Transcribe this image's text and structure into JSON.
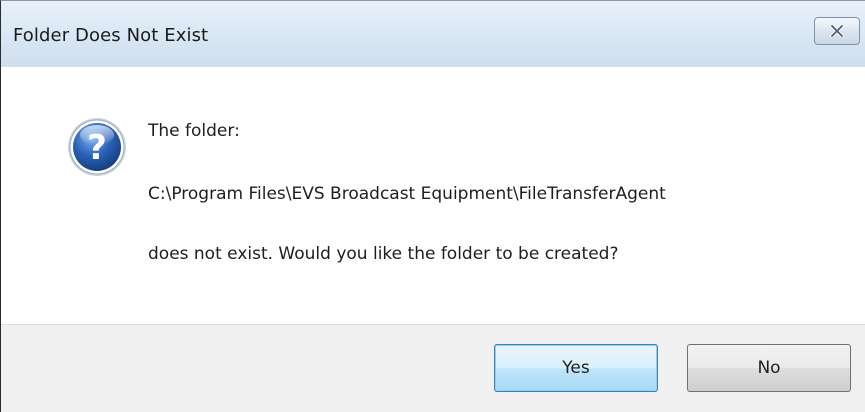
{
  "dialog": {
    "title": "Folder Does Not Exist",
    "close_icon": "close-icon",
    "icon": "question-icon",
    "message": {
      "line1": "The folder:",
      "path": "C:\\Program Files\\EVS Broadcast Equipment\\FileTransferAgent",
      "line3": "does not exist. Would you like the folder to be created?"
    },
    "buttons": {
      "yes_label": "Yes",
      "no_label": "No"
    },
    "colors": {
      "titlebar": "#dbe8f5",
      "footer": "#f0f0f0",
      "default_button_border": "#3c7fb1",
      "icon_blue": "#2a62b8"
    }
  }
}
